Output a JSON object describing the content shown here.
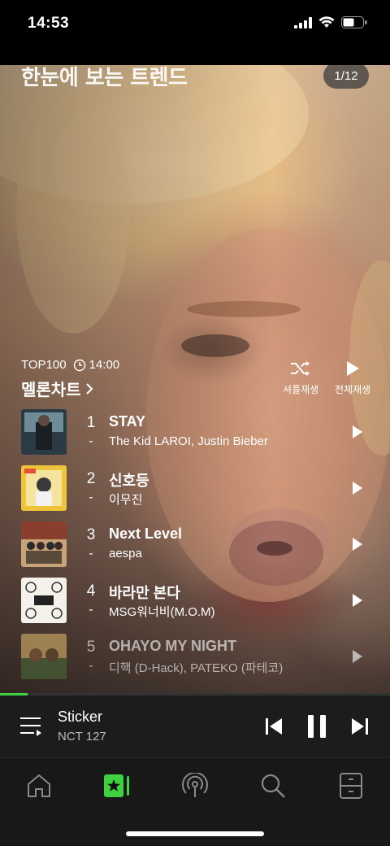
{
  "status": {
    "time": "14:53"
  },
  "hero": {
    "title": "한눈에 보는 트렌드",
    "page_indicator": "1/12"
  },
  "chart": {
    "label": "TOP100",
    "time": "14:00",
    "name": "멜론차트",
    "shuffle_label": "셔플재생",
    "play_all_label": "전체재생"
  },
  "tracks": [
    {
      "rank": "1",
      "change": "-",
      "title": "STAY",
      "artist": "The Kid LAROI, Justin Bieber"
    },
    {
      "rank": "2",
      "change": "-",
      "title": "신호등",
      "artist": "이무진"
    },
    {
      "rank": "3",
      "change": "-",
      "title": "Next Level",
      "artist": "aespa"
    },
    {
      "rank": "4",
      "change": "-",
      "title": "바라만 본다",
      "artist": "MSG워너비(M.O.M)"
    },
    {
      "rank": "5",
      "change": "-",
      "title": "OHAYO MY NIGHT",
      "artist": "디핵 (D-Hack), PATEKO (파테코)"
    }
  ],
  "player": {
    "title": "Sticker",
    "artist": "NCT 127",
    "progress": 0.07
  },
  "nav": [
    "home-icon",
    "my-music-icon",
    "podcast-icon",
    "search-icon",
    "library-icon"
  ],
  "colors": {
    "accent": "#3fd13f",
    "background": "#000000",
    "player_bg": "#1c1c1c"
  }
}
